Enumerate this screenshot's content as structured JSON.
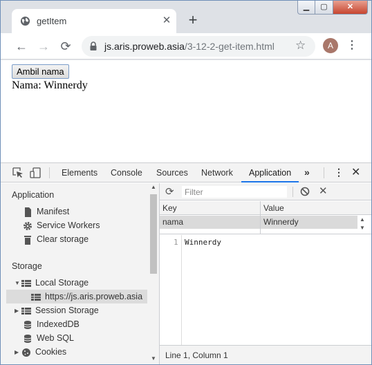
{
  "browser": {
    "tab_title": "getItem",
    "tab_close": "✕",
    "new_tab": "+",
    "window_controls": {
      "minimize": "▁",
      "maximize": "▢",
      "close": "✕"
    },
    "url_domain": "js.aris.proweb.asia",
    "url_path": "/3-12-2-get-item.html",
    "avatar_letter": "A",
    "nav": {
      "back": "←",
      "forward": "→",
      "reload": "⟳",
      "star": "☆",
      "menu": "⋮"
    }
  },
  "page": {
    "button_label": "Ambil nama",
    "result_text": "Nama: Winnerdy"
  },
  "devtools": {
    "tabs": [
      "Elements",
      "Console",
      "Sources",
      "Network",
      "Application"
    ],
    "active_tab": "Application",
    "more": "»",
    "kebab": "⋮",
    "close": "✕",
    "sidebar": {
      "application_heading": "Application",
      "application_items": [
        "Manifest",
        "Service Workers",
        "Clear storage"
      ],
      "storage_heading": "Storage",
      "local_storage": "Local Storage",
      "local_storage_origin": "https://js.aris.proweb.asia",
      "session_storage": "Session Storage",
      "indexeddb": "IndexedDB",
      "websql": "Web SQL",
      "cookies": "Cookies"
    },
    "main": {
      "filter_placeholder": "Filter",
      "columns": [
        "Key",
        "Value"
      ],
      "rows": [
        {
          "key": "nama",
          "value": "Winnerdy"
        }
      ],
      "editor_line_no": "1",
      "editor_text": "Winnerdy",
      "status": "Line 1, Column 1"
    }
  }
}
